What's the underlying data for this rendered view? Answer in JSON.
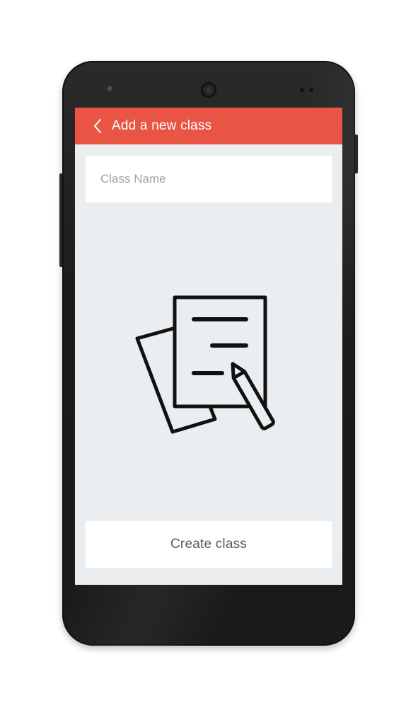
{
  "app_bar": {
    "back_icon": "chevron-left-icon",
    "title": "Add a new class",
    "color": "#ea5445"
  },
  "form": {
    "class_name": {
      "value": "",
      "placeholder": "Class Name"
    }
  },
  "illustration": {
    "icon": "documents-with-pencil-icon"
  },
  "actions": {
    "create_label": "Create class"
  },
  "colors": {
    "screen_background": "#ebeef0",
    "card_background": "#ffffff"
  }
}
